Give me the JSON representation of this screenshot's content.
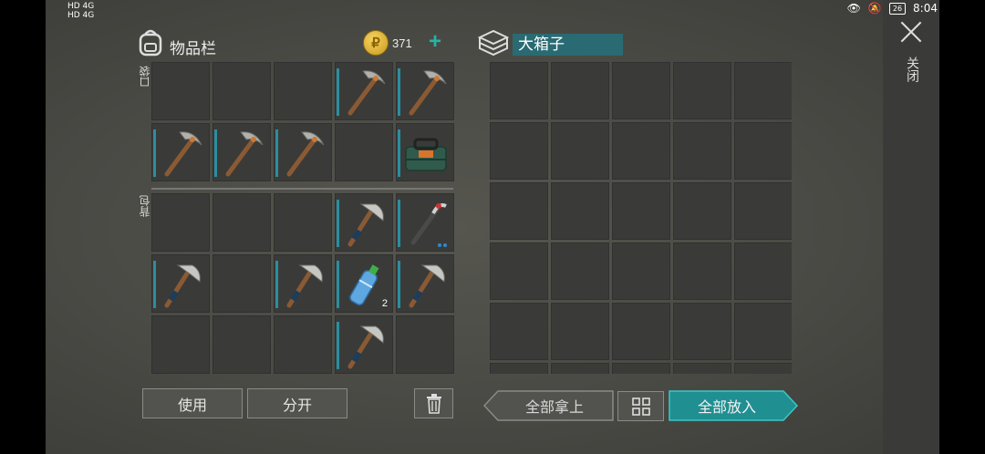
{
  "status_bar": {
    "left_line1": "HD 4G",
    "left_line2": "HD 4G",
    "time": "8:04",
    "battery": "26"
  },
  "inventory": {
    "title": "物品栏",
    "coins": "371",
    "pocket_label": "口袋",
    "backpack_label": "背包",
    "pocket_slots": [
      {
        "item": ""
      },
      {
        "item": ""
      },
      {
        "item": ""
      },
      {
        "item": "pickaxe-icon"
      },
      {
        "item": "pickaxe-icon"
      },
      {
        "item": "pickaxe-icon"
      },
      {
        "item": "pickaxe-icon"
      },
      {
        "item": "pickaxe-icon"
      },
      {
        "item": ""
      },
      {
        "item": "toolbox-icon"
      }
    ],
    "backpack_slots": [
      {
        "item": ""
      },
      {
        "item": ""
      },
      {
        "item": ""
      },
      {
        "item": "hatchet-icon"
      },
      {
        "item": "crowbar-icon"
      },
      {
        "item": "hatchet-icon"
      },
      {
        "item": ""
      },
      {
        "item": "hatchet-icon"
      },
      {
        "item": "water-bottle-icon",
        "qty": "2"
      },
      {
        "item": "hatchet-icon"
      },
      {
        "item": ""
      },
      {
        "item": ""
      },
      {
        "item": ""
      },
      {
        "item": "hatchet-icon"
      },
      {
        "item": ""
      }
    ]
  },
  "chest": {
    "title": "大箱子",
    "rows_visible": 6,
    "cols": 5
  },
  "buttons": {
    "use": "使用",
    "split": "分开",
    "take_all": "全部拿上",
    "put_all": "全部放入",
    "close": "关闭"
  },
  "colors": {
    "accent": "#27b3a8",
    "slot_bg": "#3a3b38",
    "item_bar": "#2a8ea0"
  }
}
